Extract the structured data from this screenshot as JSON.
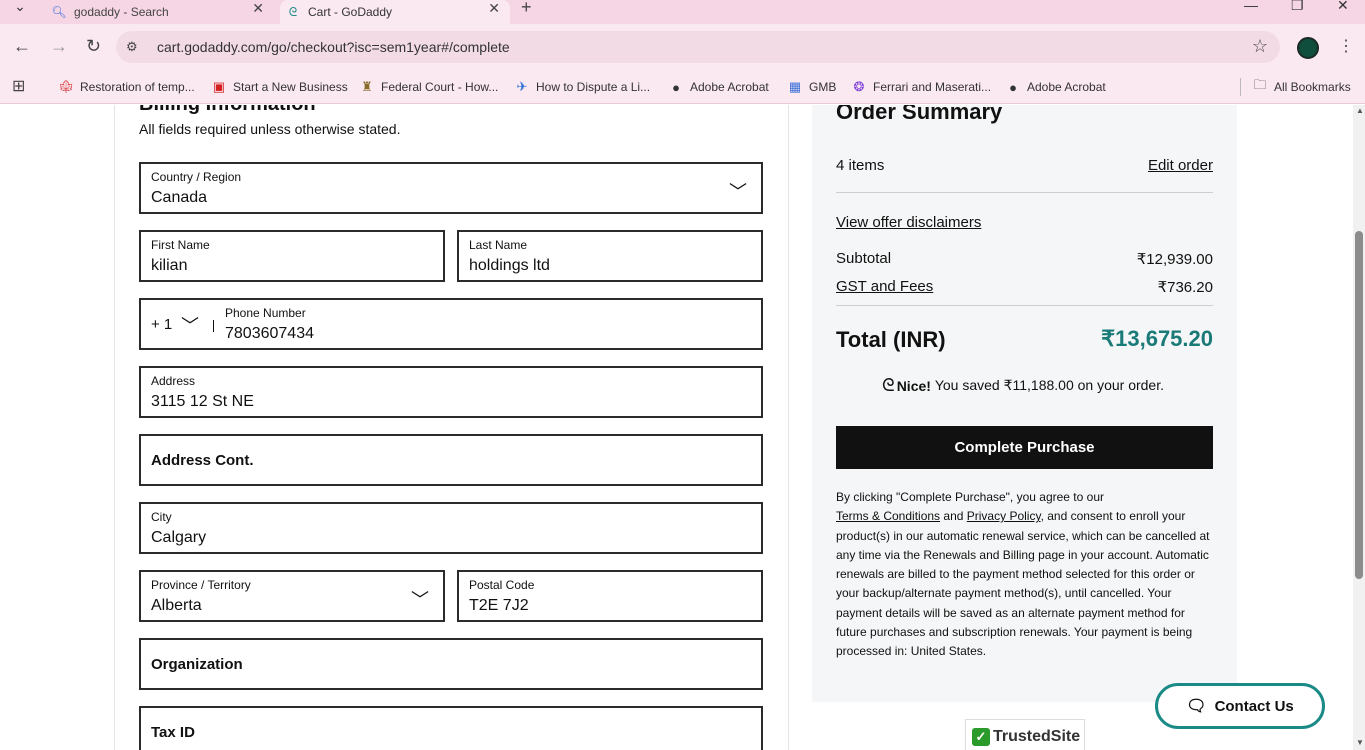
{
  "browser": {
    "tabs": [
      {
        "title": "godaddy - Search",
        "icon": "search-icon"
      },
      {
        "title": "Cart - GoDaddy",
        "icon": "godaddy-icon"
      }
    ],
    "url": "cart.godaddy.com/go/checkout?isc=sem1year#/complete",
    "bookmarks": [
      {
        "label": "Restoration of temp...",
        "icon": "maple-leaf-icon"
      },
      {
        "label": "Start a New Business",
        "icon": "canada-flag-icon"
      },
      {
        "label": "Federal Court - How...",
        "icon": "crest-icon"
      },
      {
        "label": "How to Dispute a Li...",
        "icon": "bird-icon"
      },
      {
        "label": "Adobe Acrobat",
        "icon": "globe-icon"
      },
      {
        "label": "GMB",
        "icon": "gmb-icon"
      },
      {
        "label": "Ferrari and Maserati...",
        "icon": "colorful-icon"
      },
      {
        "label": "Adobe Acrobat",
        "icon": "globe-icon"
      }
    ],
    "all_bookmarks": "All Bookmarks"
  },
  "billing": {
    "title": "Billing Information",
    "subtitle": "All fields required unless otherwise stated.",
    "country": {
      "label": "Country / Region",
      "value": "Canada"
    },
    "first_name": {
      "label": "First Name",
      "value": "kilian"
    },
    "last_name": {
      "label": "Last Name",
      "value": "holdings ltd"
    },
    "phone": {
      "code": "+ 1",
      "label": "Phone Number",
      "value": "7803607434"
    },
    "address": {
      "label": "Address",
      "value": "3115 12 St NE"
    },
    "address_cont": {
      "placeholder": "Address Cont."
    },
    "city": {
      "label": "City",
      "value": "Calgary"
    },
    "province": {
      "label": "Province / Territory",
      "value": "Alberta"
    },
    "postal": {
      "label": "Postal Code",
      "value": "T2E 7J2"
    },
    "organization": {
      "placeholder": "Organization"
    },
    "tax_id": {
      "placeholder": "Tax ID"
    }
  },
  "summary": {
    "title": "Order Summary",
    "items": "4 items",
    "edit_order": "Edit order",
    "disclaimers": "View offer disclaimers",
    "subtotal_label": "Subtotal",
    "subtotal_value": "₹12,939.00",
    "gst_label": "GST and Fees",
    "gst_value": "₹736.20",
    "total_label": "Total (INR)",
    "total_value": "₹13,675.20",
    "saved_nice": "Nice!",
    "saved_text": "You saved ₹11,188.00 on your order.",
    "complete_button": "Complete Purchase",
    "legal_1": "By clicking \"Complete Purchase\", you agree to our",
    "terms_link": "Terms & Conditions",
    "legal_and": "and",
    "privacy_link": "Privacy Policy",
    "legal_2": ", and consent to enroll your product(s) in our automatic renewal service, which can be cancelled at any time via the Renewals and Billing page in your account. Automatic renewals are billed to the payment method selected for this order or your backup/alternate payment method(s), until cancelled. Your payment details will be saved as an alternate payment method for future purchases and subscription renewals. Your payment is being processed in: United States."
  },
  "trusted_site": "TrustedSite",
  "contact_us": "Contact Us",
  "colors": {
    "accent_teal": "#1a7a78",
    "button_black": "#111111",
    "summary_bg": "#f5f6f7"
  }
}
